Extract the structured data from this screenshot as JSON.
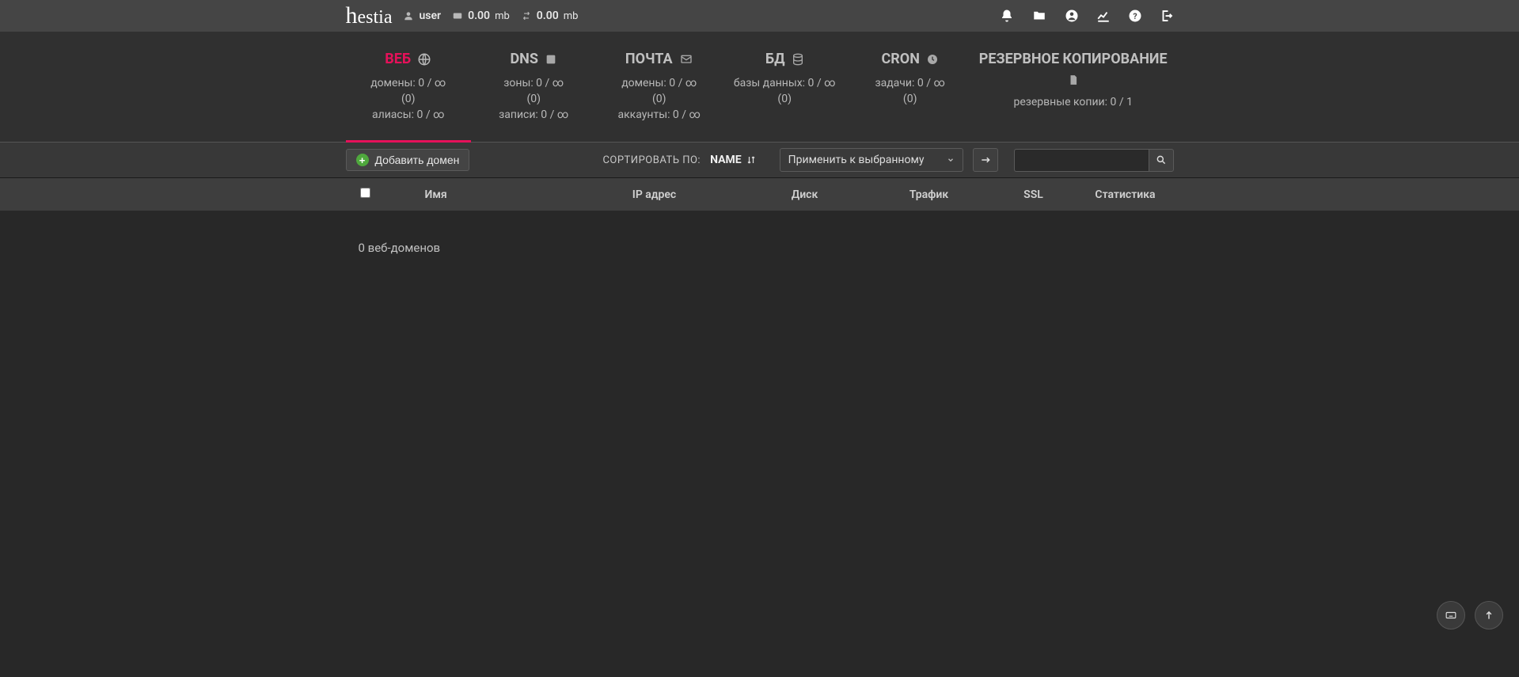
{
  "topbar": {
    "username": "user",
    "disk": "0.00",
    "disk_unit": "mb",
    "bw": "0.00",
    "bw_unit": "mb"
  },
  "tabs": {
    "web": {
      "title": "ВЕБ",
      "l1": "домены: 0 / ∞",
      "l2": "(0)",
      "l3": "алиасы: 0 / ∞"
    },
    "dns": {
      "title": "DNS",
      "l1": "зоны: 0 / ∞",
      "l2": "(0)",
      "l3": "записи: 0 / ∞"
    },
    "mail": {
      "title": "ПОЧТА",
      "l1": "домены: 0 / ∞",
      "l2": "(0)",
      "l3": "аккаунты: 0 / ∞"
    },
    "db": {
      "title": "БД",
      "l1": "базы данных: 0 / ∞",
      "l2": "(0)"
    },
    "cron": {
      "title": "CRON",
      "l1": "задачи: 0 / ∞",
      "l2": "(0)"
    },
    "backup": {
      "title": "РЕЗЕРВНОЕ КОПИРОВАНИЕ",
      "l1": "резервные копии: 0 / 1"
    }
  },
  "toolbar": {
    "add_domain": "Добавить домен",
    "sort_label": "СОРТИРОВАТЬ ПО:",
    "sort_value": "NAME",
    "bulk_label": "Применить к выбранному"
  },
  "columns": {
    "name": "Имя",
    "ip": "IP адрес",
    "disk": "Диск",
    "traffic": "Трафик",
    "ssl": "SSL",
    "stats": "Статистика"
  },
  "body": {
    "empty": "0 веб-доменов"
  }
}
